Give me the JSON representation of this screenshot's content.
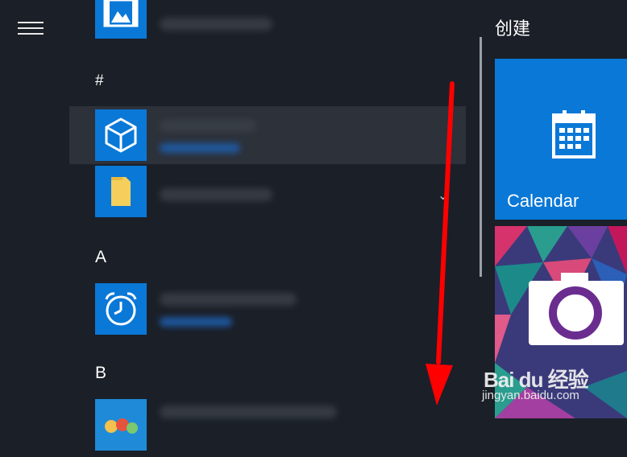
{
  "start_menu": {
    "sections": {
      "hash": "#",
      "a": "A",
      "b": "B"
    },
    "icons": {
      "menu": "hamburger-icon",
      "video_app": "film-photo-icon",
      "3d_app": "3d-cube-icon",
      "folder_app": "folder-icon",
      "alarms_app": "alarm-clock-icon",
      "b_app": "colorful-game-icon",
      "expand": "chevron-down-icon"
    },
    "expand_glyph": "⌄"
  },
  "tiles": {
    "group_title": "创建",
    "calendar_label": "Calendar"
  },
  "watermark": {
    "logo_text": "Bai du 经验",
    "url": "jingyan.baidu.com"
  },
  "colors": {
    "background": "#1a1f28",
    "tile_blue": "#0a78d7",
    "highlight_row": "#2c313a",
    "annotation_arrow": "#ff0000"
  }
}
